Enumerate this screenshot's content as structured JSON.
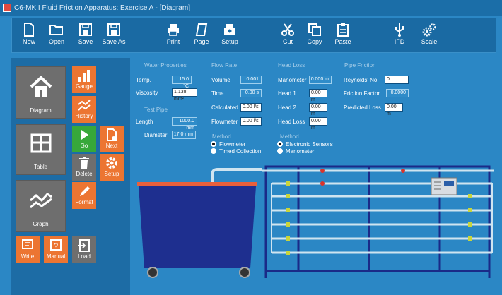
{
  "window": {
    "title": "C6-MKII Fluid Friction Apparatus:  Exercise A - [Diagram]"
  },
  "toolbar": {
    "new": "New",
    "open": "Open",
    "save": "Save",
    "save_as": "Save As",
    "print": "Print",
    "page": "Page",
    "setup": "Setup",
    "cut": "Cut",
    "copy": "Copy",
    "paste": "Paste",
    "ifd": "IFD",
    "scale": "Scale"
  },
  "sidebar": {
    "diagram": "Diagram",
    "table": "Table",
    "graph": "Graph",
    "gauge": "Gauge",
    "history": "History",
    "go": "Go",
    "next": "Next",
    "delete": "Delete",
    "setup": "Setup",
    "format": "Format",
    "write": "Write",
    "manual": "Manual",
    "load": "Load"
  },
  "water_properties": {
    "heading": "Water Properties",
    "temp_label": "Temp.",
    "temp_value": "15.0 °C",
    "viscosity_label": "Viscosity",
    "viscosity_value": "1.138 mm²"
  },
  "test_pipe": {
    "heading": "Test Pipe",
    "length_label": "Length",
    "length_value": "1000.0 mm",
    "diameter_label": "Diameter",
    "diameter_value": "17.0 mm"
  },
  "flow_rate": {
    "heading": "Flow Rate",
    "volume_label": "Volume",
    "volume_value": "0.001",
    "time_label": "Time",
    "time_value": "0.00 s",
    "calculated_label": "Calculated",
    "calculated_value": "0.00 l/s",
    "flowmeter_label": "Flowmeter",
    "flowmeter_value": "0.00 l/s",
    "method_heading": "Method",
    "method_options": [
      "Flowmeter",
      "Timed Collection"
    ],
    "method_selected": "Flowmeter"
  },
  "head_loss": {
    "heading": "Head Loss",
    "manometer_label": "Manometer",
    "manometer_value": "0.000 m",
    "head1_label": "Head 1",
    "head1_value": "0.00 m",
    "head2_label": "Head 2",
    "head2_value": "0.00 m",
    "headloss_label": "Head Loss",
    "headloss_value": "0.00 m",
    "method_heading": "Method",
    "method_options": [
      "Electronic Sensors",
      "Manometer"
    ],
    "method_selected": "Electronic Sensors"
  },
  "pipe_friction": {
    "heading": "Pipe Friction",
    "reynolds_label": "Reynolds' No.",
    "reynolds_value": "0",
    "friction_label": "Friction Factor",
    "friction_value": "0.0000",
    "predicted_label": "Predicted Loss",
    "predicted_value": "0.00 m"
  },
  "colors": {
    "background": "#2b87c5",
    "toolbar": "#1a6aa3",
    "accent_orange": "#ec7532",
    "accent_green": "#37a83a",
    "tank_blue": "#1e2f8f"
  }
}
